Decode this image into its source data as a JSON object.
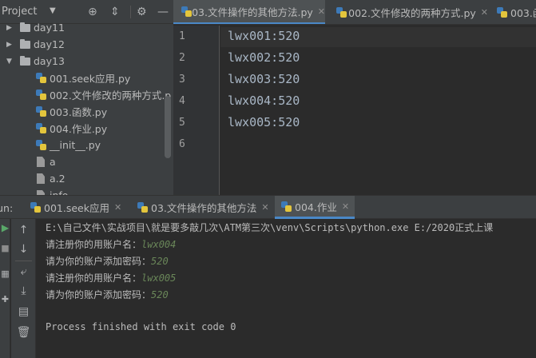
{
  "project": {
    "title": "Project",
    "tree": [
      {
        "label": "day11",
        "type": "folder",
        "expanded": false
      },
      {
        "label": "day12",
        "type": "folder",
        "expanded": false
      },
      {
        "label": "day13",
        "type": "folder",
        "expanded": true
      },
      {
        "label": "001.seek应用.py",
        "type": "python"
      },
      {
        "label": "002.文件修改的两种方式.p",
        "type": "python"
      },
      {
        "label": "003.函数.py",
        "type": "python"
      },
      {
        "label": "004.作业.py",
        "type": "python"
      },
      {
        "label": "__init__.py",
        "type": "python"
      },
      {
        "label": "a",
        "type": "file"
      },
      {
        "label": "a.2",
        "type": "file"
      },
      {
        "label": "info",
        "type": "file"
      }
    ]
  },
  "editor": {
    "tabs": [
      {
        "label": "03.文件操作的其他方法.py",
        "active": true
      },
      {
        "label": "002.文件修改的两种方式.py",
        "active": false
      },
      {
        "label": "003.函",
        "active": false
      }
    ],
    "lines": [
      {
        "no": "1",
        "text": "lwx001:520"
      },
      {
        "no": "2",
        "text": "lwx002:520"
      },
      {
        "no": "3",
        "text": "lwx003:520"
      },
      {
        "no": "4",
        "text": "lwx004:520"
      },
      {
        "no": "5",
        "text": "lwx005:520"
      },
      {
        "no": "6",
        "text": ""
      }
    ]
  },
  "run": {
    "label": "Run:",
    "tabs": [
      {
        "label": "001.seek应用",
        "active": false
      },
      {
        "label": "03.文件操作的其他方法",
        "active": false
      },
      {
        "label": "004.作业",
        "active": true
      }
    ],
    "console": [
      {
        "prompt": "E:\\自己文件\\实战项目\\就是要多敲几次\\ATM第三次\\venv\\Scripts\\python.exe E:/2020正式上课",
        "input": ""
      },
      {
        "prompt": "请注册你的用账户名：",
        "input": "lwx004"
      },
      {
        "prompt": "请为你的账户添加密码：",
        "input": "520"
      },
      {
        "prompt": "请注册你的用账户名：",
        "input": "lwx005"
      },
      {
        "prompt": "请为你的账户添加密码：",
        "input": "520"
      },
      {
        "prompt": "",
        "input": ""
      },
      {
        "prompt": "Process finished with exit code 0",
        "input": ""
      }
    ]
  },
  "colors": {
    "background": "#2b2b2b",
    "panel": "#3c3f41",
    "accent": "#4a88c7",
    "console_input": "#6a8759",
    "run_green": "#59a869"
  }
}
